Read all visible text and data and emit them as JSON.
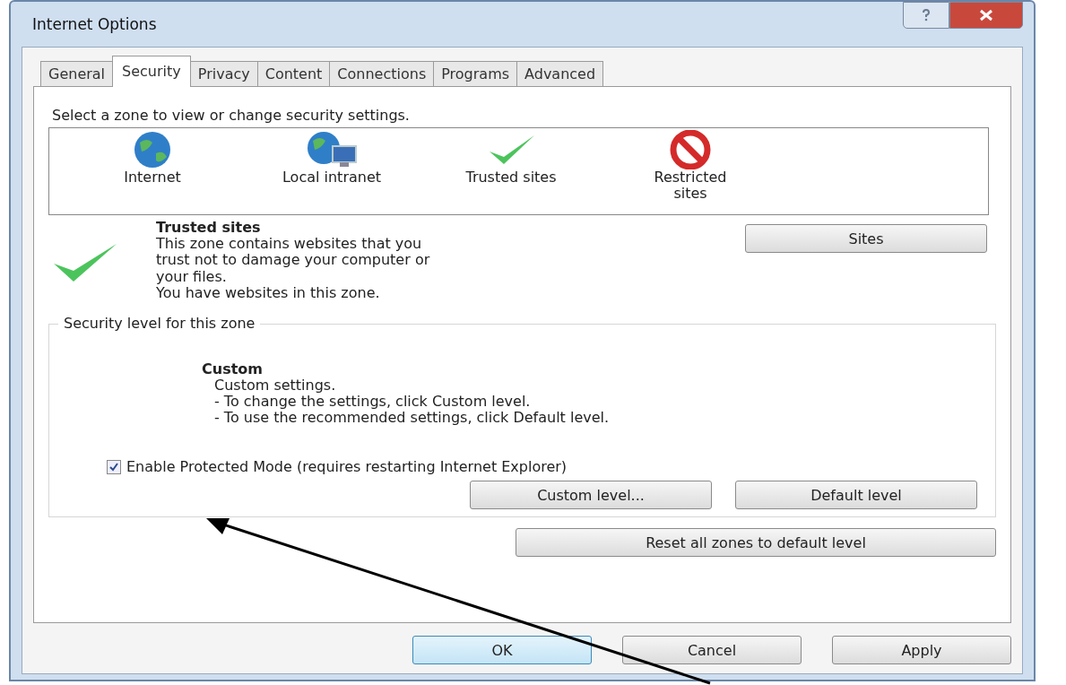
{
  "window": {
    "title": "Internet Options"
  },
  "tabs": [
    {
      "label": "General",
      "selected": false
    },
    {
      "label": "Security",
      "selected": true
    },
    {
      "label": "Privacy",
      "selected": false
    },
    {
      "label": "Content",
      "selected": false
    },
    {
      "label": "Connections",
      "selected": false
    },
    {
      "label": "Programs",
      "selected": false
    },
    {
      "label": "Advanced",
      "selected": false
    }
  ],
  "prompt": "Select a zone to view or change security settings.",
  "zones": [
    {
      "kind": "globe",
      "label": "Internet"
    },
    {
      "kind": "network",
      "label": "Local intranet"
    },
    {
      "kind": "check",
      "label": "Trusted sites"
    },
    {
      "kind": "blocked",
      "label": "Restricted sites"
    }
  ],
  "zone_detail": {
    "kind": "check",
    "title": "Trusted sites",
    "description": [
      "This zone contains websites that you",
      "trust not to damage your computer or",
      "your files.",
      "You have websites in this zone."
    ],
    "button": "Sites"
  },
  "security_level": {
    "legend": "Security level for this zone",
    "title": "Custom",
    "lines": [
      "Custom settings.",
      "- To change the settings, click Custom level.",
      "- To use the recommended settings, click Default level."
    ],
    "protected_mode": {
      "label": "Enable Protected Mode (requires restarting Internet Explorer)",
      "checked": true
    },
    "buttons": [
      "Custom level...",
      "Default level"
    ]
  },
  "reset_button": "Reset all zones to default level",
  "dialog_buttons": [
    {
      "label": "OK",
      "default": true
    },
    {
      "label": "Cancel",
      "default": false
    },
    {
      "label": "Apply",
      "default": false
    }
  ]
}
